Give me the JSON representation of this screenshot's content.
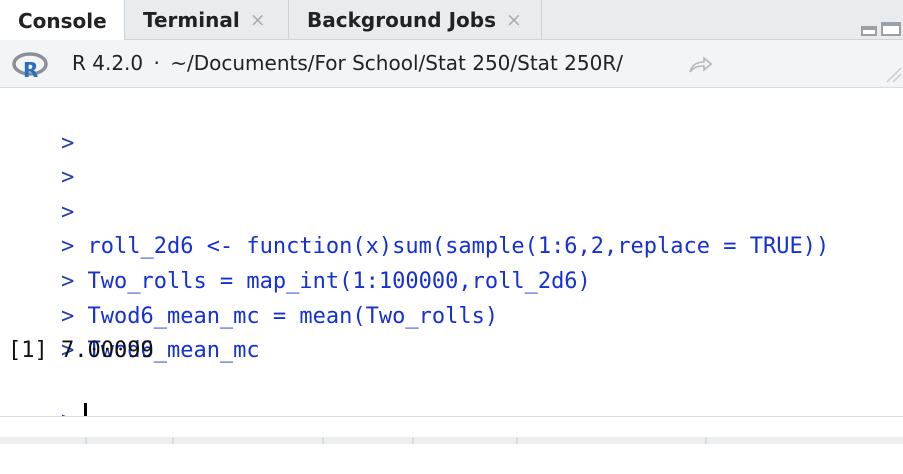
{
  "tabs": [
    {
      "label": "Console",
      "active": true,
      "closable": false
    },
    {
      "label": "Terminal",
      "active": false,
      "closable": true
    },
    {
      "label": "Background Jobs",
      "active": false,
      "closable": true
    }
  ],
  "close_glyph": "×",
  "pathbar": {
    "r_version": "R 4.2.0",
    "separator": "·",
    "working_dir": "~/Documents/For School/Stat 250/Stat 250R/",
    "icons": [
      "r-logo-icon",
      "go-to-directory-icon"
    ]
  },
  "console": {
    "prompt": ">",
    "lines": [
      {
        "kind": "prompt",
        "text": ""
      },
      {
        "kind": "prompt",
        "text": ""
      },
      {
        "kind": "prompt",
        "text": ""
      },
      {
        "kind": "command",
        "text": "roll_2d6 <- function(x)sum(sample(1:6,2,replace = TRUE))"
      },
      {
        "kind": "command",
        "text": "Two_rolls = map_int(1:100000,roll_2d6)"
      },
      {
        "kind": "command",
        "text": "Twod6_mean_mc = mean(Two_rolls)"
      },
      {
        "kind": "command",
        "text": "Twod6_mean_mc"
      },
      {
        "kind": "output",
        "text": "[1] 7.00099"
      }
    ]
  },
  "colors": {
    "prompt": "#1f3fa8",
    "command": "#1430d6",
    "output": "#111111",
    "tabbar_bg": "#e9ecef",
    "pathbar_bg": "#f3f4f6"
  }
}
